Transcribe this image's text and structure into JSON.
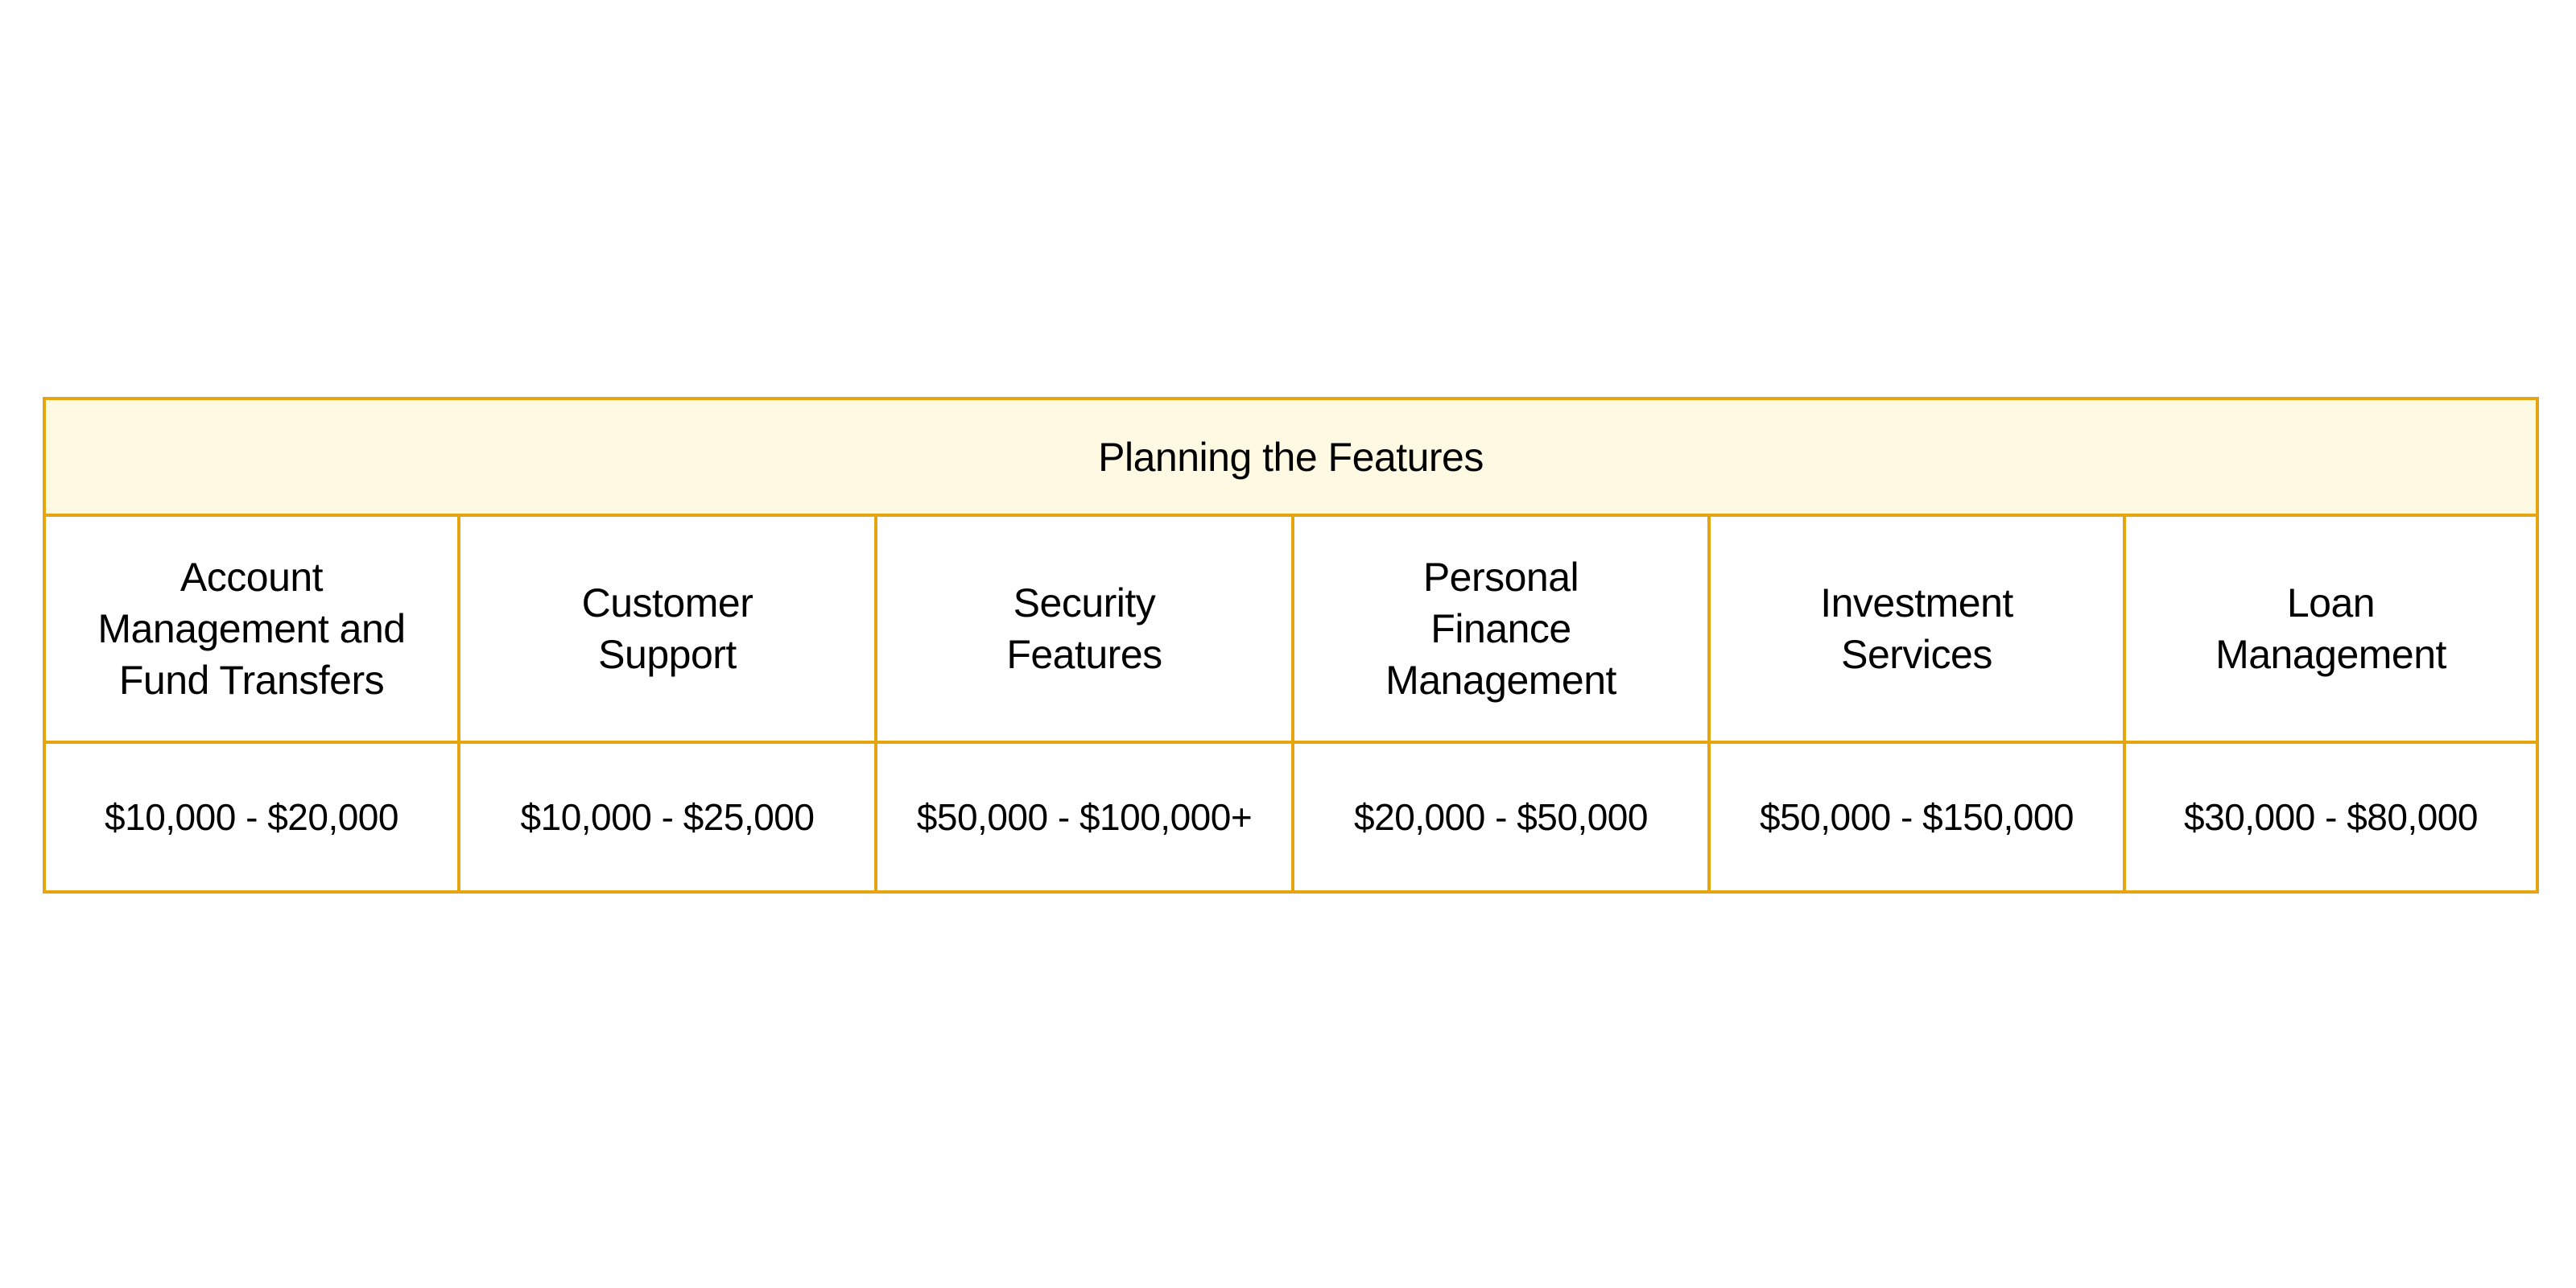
{
  "table": {
    "title": "Planning the Features",
    "colors": {
      "border": "#e6a40e",
      "title_bg": "#fef9e3"
    },
    "columns": [
      {
        "feature": "Account\nManagement and\nFund Transfers",
        "cost": "$10,000 - $20,000"
      },
      {
        "feature": "Customer\nSupport",
        "cost": "$10,000 - $25,000"
      },
      {
        "feature": "Security\nFeatures",
        "cost": "$50,000 - $100,000+"
      },
      {
        "feature": "Personal\nFinance\nManagement",
        "cost": "$20,000 - $50,000"
      },
      {
        "feature": "Investment\nServices",
        "cost": "$50,000 - $150,000"
      },
      {
        "feature": "Loan\nManagement",
        "cost": "$30,000 - $80,000"
      }
    ]
  }
}
